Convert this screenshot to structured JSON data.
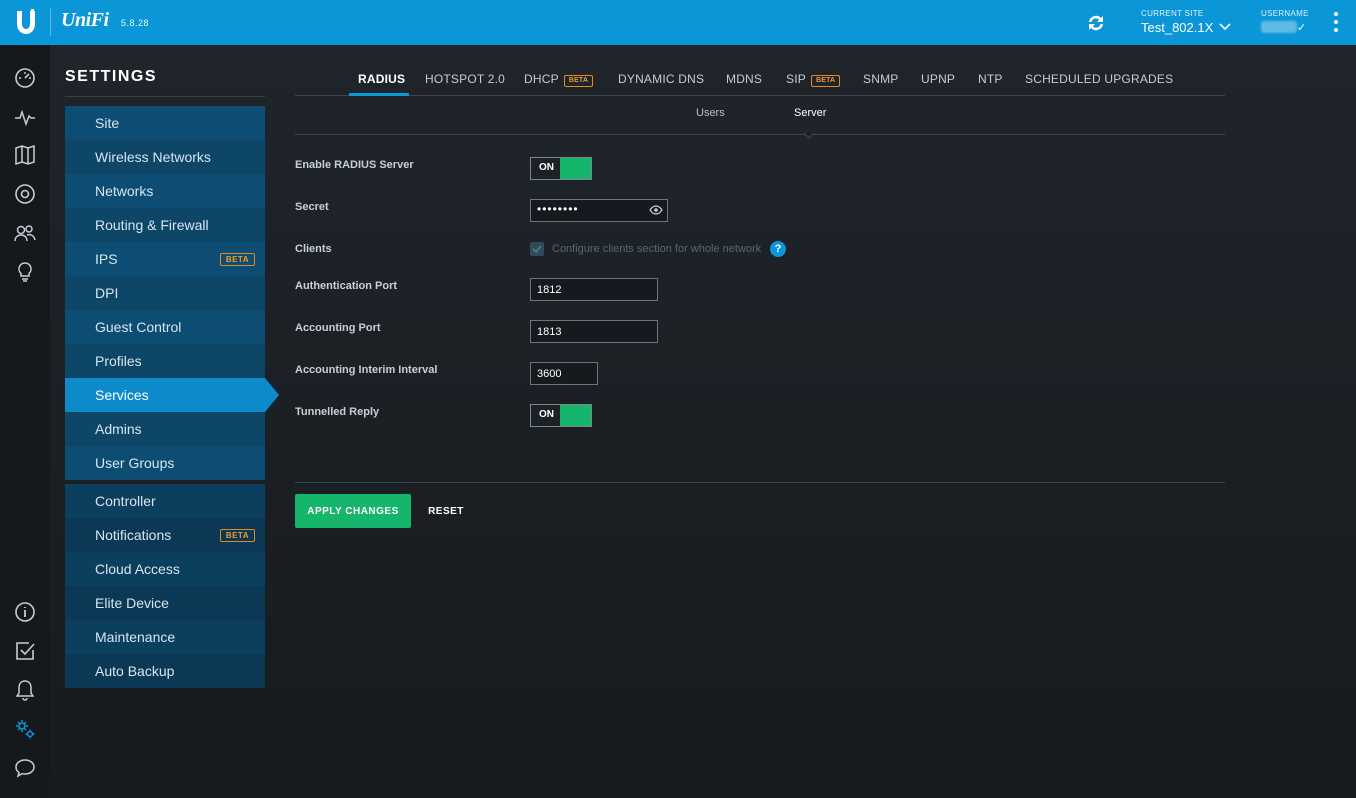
{
  "header": {
    "logo_text": "UniFi",
    "version": "5.8.28",
    "current_site_label": "CURRENT SITE",
    "current_site": "Test_802.1X",
    "username_label": "USERNAME",
    "username_check": "✓"
  },
  "rail_icons": [
    "dashboard-icon",
    "statistics-icon",
    "map-icon",
    "devices-icon",
    "clients-icon",
    "insights-icon",
    "info-icon",
    "tasks-icon",
    "alerts-icon",
    "settings-icon",
    "chat-icon"
  ],
  "settings": {
    "title": "SETTINGS",
    "group1": [
      {
        "label": "Site"
      },
      {
        "label": "Wireless Networks"
      },
      {
        "label": "Networks"
      },
      {
        "label": "Routing & Firewall"
      },
      {
        "label": "IPS",
        "badge": "BETA"
      },
      {
        "label": "DPI"
      },
      {
        "label": "Guest Control"
      },
      {
        "label": "Profiles"
      },
      {
        "label": "Services",
        "active": true
      },
      {
        "label": "Admins"
      },
      {
        "label": "User Groups"
      }
    ],
    "group2": [
      {
        "label": "Controller"
      },
      {
        "label": "Notifications",
        "badge": "BETA"
      },
      {
        "label": "Cloud Access"
      },
      {
        "label": "Elite Device"
      },
      {
        "label": "Maintenance"
      },
      {
        "label": "Auto Backup"
      }
    ]
  },
  "tabs": [
    {
      "label": "RADIUS",
      "active": true
    },
    {
      "label": "HOTSPOT 2.0"
    },
    {
      "label": "DHCP",
      "badge": "BETA"
    },
    {
      "label": "DYNAMIC DNS"
    },
    {
      "label": "MDNS"
    },
    {
      "label": "SIP",
      "badge": "BETA"
    },
    {
      "label": "SNMP"
    },
    {
      "label": "UPNP"
    },
    {
      "label": "NTP"
    },
    {
      "label": "SCHEDULED UPGRADES"
    }
  ],
  "subtabs": {
    "users": "Users",
    "server": "Server",
    "active": "Server"
  },
  "form": {
    "enable_radius_label": "Enable RADIUS Server",
    "enable_radius_value": "ON",
    "secret_label": "Secret",
    "secret_masked": "••••••••",
    "clients_label": "Clients",
    "clients_checkbox_label": "Configure clients section for whole network",
    "clients_checked": true,
    "help": "?",
    "auth_port_label": "Authentication Port",
    "auth_port": "1812",
    "acct_port_label": "Accounting Port",
    "acct_port": "1813",
    "interim_label": "Accounting Interim Interval",
    "interim": "3600",
    "tunnelled_label": "Tunnelled Reply",
    "tunnelled_value": "ON"
  },
  "actions": {
    "apply": "APPLY CHANGES",
    "reset": "RESET"
  },
  "colors": {
    "brand": "#0b96d8",
    "accent_green": "#15b56b",
    "beta": "#f09a30"
  }
}
